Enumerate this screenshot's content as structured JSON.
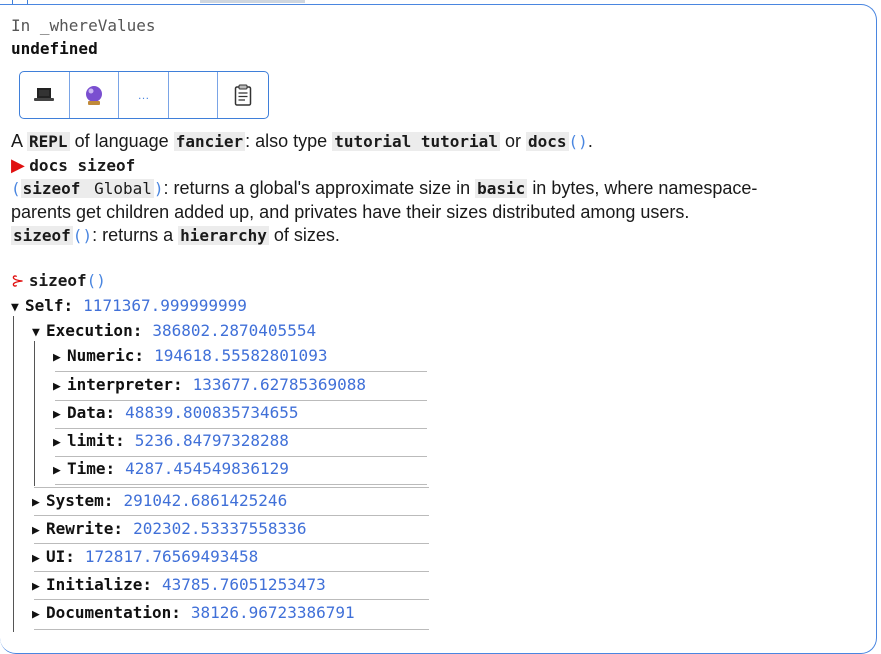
{
  "cell": {
    "in_label": "In _whereValues",
    "result": "undefined"
  },
  "toolbar": {
    "buttons": [
      {
        "icon": "laptop-icon"
      },
      {
        "icon": "crystal-ball-icon"
      },
      {
        "icon": "ellipsis-icon",
        "label": "…"
      },
      {
        "icon": "blank-icon"
      },
      {
        "icon": "clipboard-icon"
      }
    ]
  },
  "intro": {
    "a": "A",
    "repl": "REPL",
    "of_language": "of language",
    "lang": "fancier",
    "also": ": also type",
    "tutorial": "tutorial tutorial",
    "or": "or",
    "docs": "docs",
    "paren_open": "(",
    "paren_close": ")",
    "period": "."
  },
  "docs_cmd": {
    "prompt": "▶",
    "text": "docs sizeof"
  },
  "docs_text": {
    "sig_open": "(",
    "sig_fn": "sizeof",
    "sig_arg": " Global",
    "sig_close": ")",
    "line1_a": ": returns a global's approximate size in",
    "basic": "basic",
    "line1_b": "in bytes, where namespace-",
    "line2": "parents get children added up, and privates have their sizes distributed among users.",
    "fn2": "sizeof",
    "p_open": "(",
    "p_close": ")",
    "line3_a": ": returns a",
    "hierarchy": "hierarchy",
    "line3_b": "of sizes."
  },
  "sizeof_cmd": {
    "prompt": "⊱",
    "fn": "sizeof",
    "p_open": "(",
    "p_close": ")"
  },
  "tree": {
    "self": {
      "key": "Self:",
      "value": "1171367.999999999"
    },
    "execution": {
      "key": "Execution:",
      "value": "386802.2870405554"
    },
    "exec_children": [
      {
        "key": "Numeric:",
        "value": "194618.55582801093"
      },
      {
        "key": "interpreter:",
        "value": "133677.62785369088"
      },
      {
        "key": "Data:",
        "value": "48839.800835734655"
      },
      {
        "key": "limit:",
        "value": "5236.84797328288"
      },
      {
        "key": "Time:",
        "value": "4287.454549836129"
      }
    ],
    "self_children": [
      {
        "key": "System:",
        "value": "291042.6861425246"
      },
      {
        "key": "Rewrite:",
        "value": "202302.53337558336"
      },
      {
        "key": "UI:",
        "value": "172817.76569493458"
      },
      {
        "key": "Initialize:",
        "value": "43785.76051253473"
      },
      {
        "key": "Documentation:",
        "value": "38126.96723386791"
      }
    ]
  },
  "colors": {
    "accent": "#4a86e0",
    "value": "#4070d8",
    "prompt": "#e01010"
  }
}
